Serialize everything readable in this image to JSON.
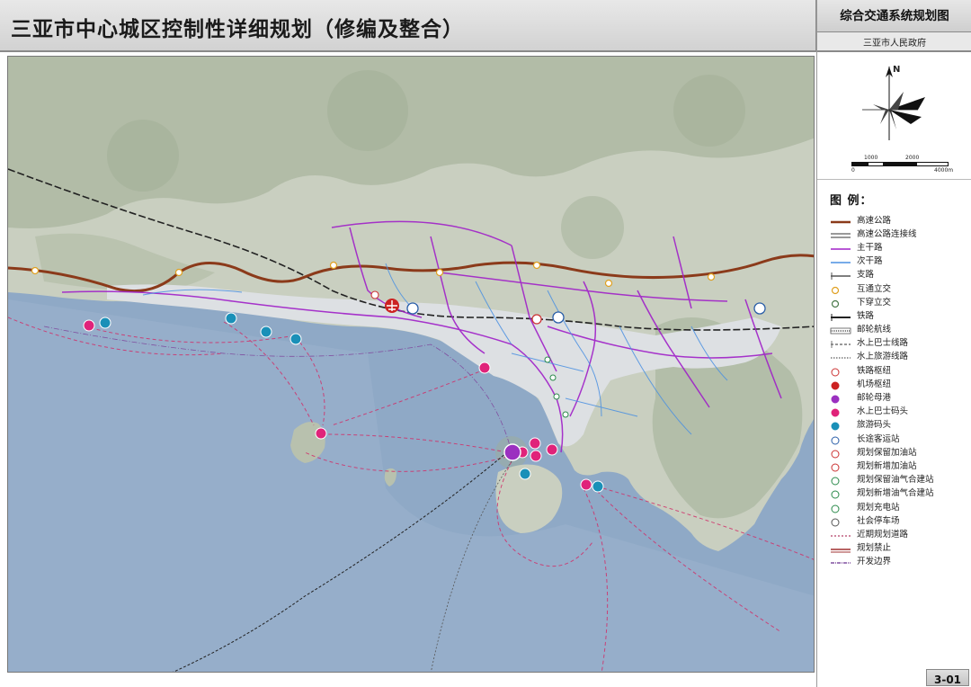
{
  "header": {
    "title": "三亚市中心城区控制性详细规划（修编及整合）"
  },
  "side_panel": {
    "map_title": "综合交通系统规划图",
    "government": "三亚市人民政府",
    "north": "N",
    "scale": {
      "labels": [
        "0",
        "1000",
        "2000",
        "4000m"
      ]
    }
  },
  "legend": {
    "title": "图 例：",
    "items": [
      {
        "label": "高速公路",
        "icon": "expressway-line",
        "color": "#8b3a1a"
      },
      {
        "label": "高速公路连接线",
        "icon": "expressway-link-line",
        "color": "#333333"
      },
      {
        "label": "主干路",
        "icon": "arterial-road-line",
        "color": "#a020c8"
      },
      {
        "label": "次干路",
        "icon": "secondary-road-line",
        "color": "#4a90e2"
      },
      {
        "label": "支路",
        "icon": "branch-road-line",
        "color": "#555555"
      },
      {
        "label": "互通立交",
        "icon": "interchange-circle",
        "color": "#e0a020"
      },
      {
        "label": "下穿立交",
        "icon": "underpass-circle",
        "color": "#4a7a4a"
      },
      {
        "label": "铁路",
        "icon": "railway-line",
        "color": "#222222"
      },
      {
        "label": "邮轮航线",
        "icon": "cruise-route-line",
        "color": "#555555"
      },
      {
        "label": "水上巴士线路",
        "icon": "water-bus-line",
        "color": "#777777"
      },
      {
        "label": "水上旅游线路",
        "icon": "water-tour-line",
        "color": "#777777"
      },
      {
        "label": "铁路枢纽",
        "icon": "rail-hub-icon",
        "color": "#cc3333"
      },
      {
        "label": "机场枢纽",
        "icon": "airport-hub-icon",
        "color": "#cc2222"
      },
      {
        "label": "邮轮母港",
        "icon": "cruise-port-icon",
        "color": "#9b30c0"
      },
      {
        "label": "水上巴士码头",
        "icon": "water-bus-pier-icon",
        "color": "#e0237a"
      },
      {
        "label": "旅游码头",
        "icon": "tour-pier-icon",
        "color": "#1a90b8"
      },
      {
        "label": "长途客运站",
        "icon": "bus-station-icon",
        "color": "#2a5ea8"
      },
      {
        "label": "规划保留加油站",
        "icon": "gas-station-keep-icon",
        "color": "#cc3333"
      },
      {
        "label": "规划新增加油站",
        "icon": "gas-station-new-icon",
        "color": "#cc3333"
      },
      {
        "label": "规划保留油气合建站",
        "icon": "oil-gas-keep-icon",
        "color": "#2a8a4a"
      },
      {
        "label": "规划新增油气合建站",
        "icon": "oil-gas-new-icon",
        "color": "#2a8a4a"
      },
      {
        "label": "规划充电站",
        "icon": "charging-station-icon",
        "color": "#2a8a4a"
      },
      {
        "label": "社会停车场",
        "icon": "parking-icon",
        "color": "#555555"
      },
      {
        "label": "近期规划道路",
        "icon": "near-term-road-line",
        "color": "#c06080"
      },
      {
        "label": "规划禁止",
        "icon": "planned-prohibit-line",
        "color": "#a03030"
      },
      {
        "label": "开发边界",
        "icon": "development-boundary-line",
        "color": "#8050a0"
      }
    ]
  },
  "colors": {
    "sea": "#8fa9c6",
    "land": "#c9cfc0",
    "terrain_dark": "#a9b59f",
    "urban": "#dde0e3",
    "expressway": "#8b3a1a",
    "arterial": "#a020c8",
    "secondary": "#4a90e2",
    "water_route": "#d0306a"
  },
  "page_number": "3-01"
}
